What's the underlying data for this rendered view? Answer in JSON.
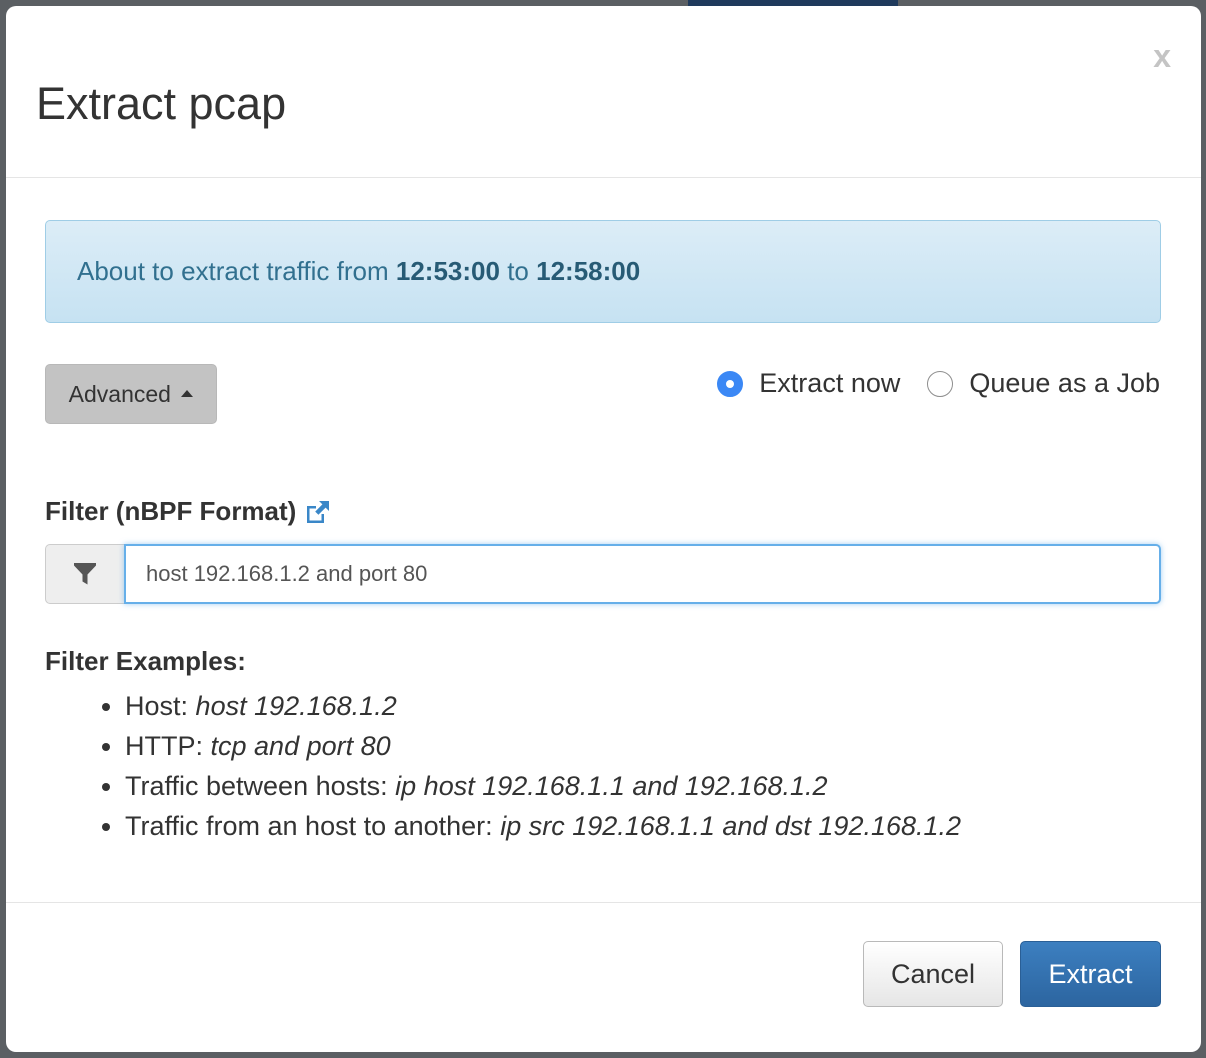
{
  "dialog": {
    "title": "Extract pcap",
    "close_label": "x"
  },
  "info": {
    "prefix": "About to extract traffic from",
    "start_time": "12:53:00",
    "connector": "to",
    "end_time": "12:58:00"
  },
  "advanced_button": {
    "label": "Advanced"
  },
  "mode": {
    "options": [
      {
        "label": "Extract now",
        "checked": true
      },
      {
        "label": "Queue as a Job",
        "checked": false
      }
    ]
  },
  "filter": {
    "label": "Filter (nBPF Format)",
    "value": "host 192.168.1.2 and port 80",
    "icon": "filter-icon",
    "link_icon": "external-link-icon"
  },
  "examples": {
    "title": "Filter Examples:",
    "items": [
      {
        "name": "Host:",
        "expr": "host 192.168.1.2"
      },
      {
        "name": "HTTP:",
        "expr": "tcp and port 80"
      },
      {
        "name": "Traffic between hosts:",
        "expr": "ip host 192.168.1.1 and 192.168.1.2"
      },
      {
        "name": "Traffic from an host to another:",
        "expr": "ip src 192.168.1.1 and dst 192.168.1.2"
      }
    ]
  },
  "footer": {
    "cancel_label": "Cancel",
    "extract_label": "Extract"
  },
  "colors": {
    "primary": "#337ab7",
    "info_text": "#31708f",
    "radio_checked": "#3b88f5"
  }
}
